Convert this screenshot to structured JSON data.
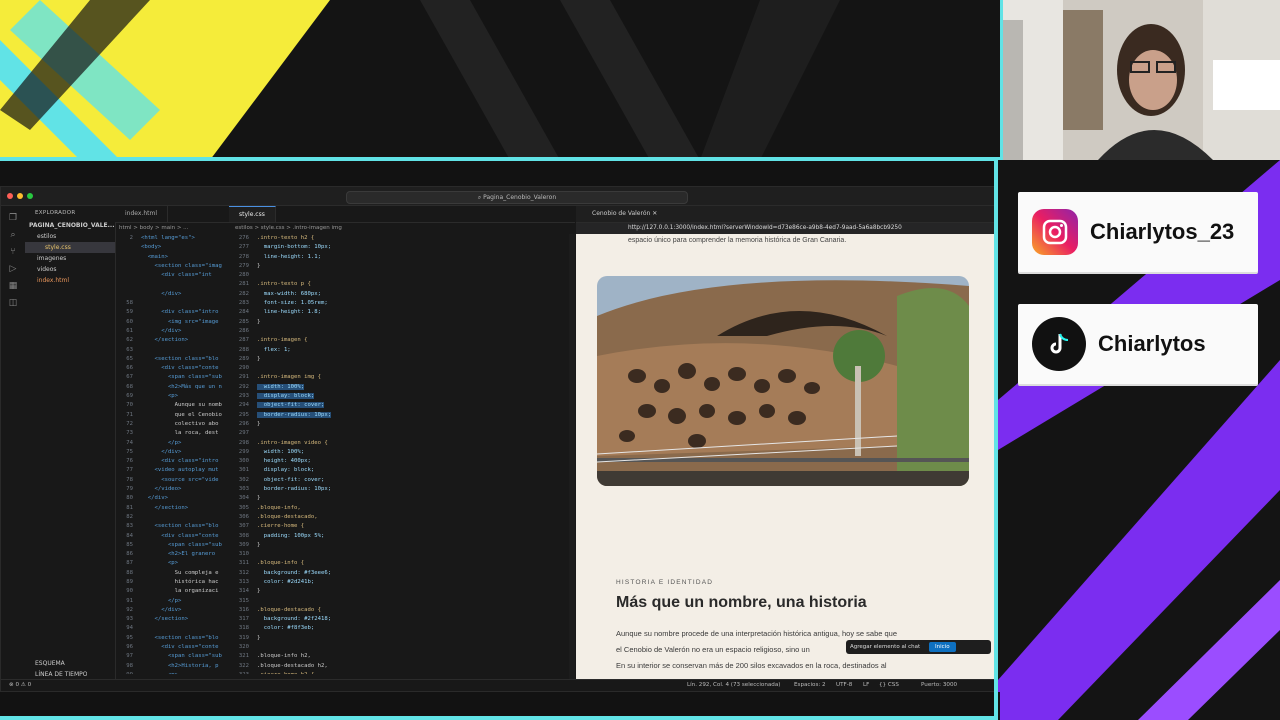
{
  "socials": {
    "instagram": "Chiarlytos_23",
    "tiktok": "Chiarlytos"
  },
  "editor": {
    "command_center": "Pagina_Cenobio_Valeron",
    "explorer_title": "EXPLORADOR",
    "project": "PAGINA_CENOBIO_VALE...",
    "tree": [
      "estilos",
      "style.css",
      "imagenes",
      "videos",
      "index.html"
    ],
    "outline": "ESQUEMA",
    "timeline": "LÍNEA DE TIEMPO",
    "tabs": [
      "index.html",
      "style.css"
    ],
    "breadcrumb_left": "html > body > main > ...",
    "breadcrumb_right": "estilos > style.css > .intro-imagen img",
    "html_lines": [
      {
        "n": "2",
        "c": "<html lang=\"es\">"
      },
      {
        "n": "",
        "c": "<body>"
      },
      {
        "n": "",
        "c": "  <main>"
      },
      {
        "n": "",
        "c": "    <section class=\"imag"
      },
      {
        "n": "",
        "c": "      <div class=\"int"
      },
      {
        "n": "",
        "c": ""
      },
      {
        "n": "",
        "c": "      </div>"
      },
      {
        "n": "58",
        "c": ""
      },
      {
        "n": "59",
        "c": "      <div class=\"intro"
      },
      {
        "n": "60",
        "c": "        <img src=\"image"
      },
      {
        "n": "61",
        "c": "      </div>"
      },
      {
        "n": "62",
        "c": "    </section>"
      },
      {
        "n": "63",
        "c": ""
      },
      {
        "n": "65",
        "c": "    <section class=\"blo"
      },
      {
        "n": "66",
        "c": "      <div class=\"conte"
      },
      {
        "n": "67",
        "c": "        <span class=\"sub"
      },
      {
        "n": "68",
        "c": "        <h2>Más que un n"
      },
      {
        "n": "69",
        "c": "        <p>"
      },
      {
        "n": "70",
        "c": "          Aunque su nomb"
      },
      {
        "n": "71",
        "c": "          que el Cenobio"
      },
      {
        "n": "72",
        "c": "          colectivo abo"
      },
      {
        "n": "73",
        "c": "          la roca, dest"
      },
      {
        "n": "74",
        "c": "        </p>"
      },
      {
        "n": "75",
        "c": "      </div>"
      },
      {
        "n": "76",
        "c": "      <div class=\"intro"
      },
      {
        "n": "77",
        "c": "    <video autoplay mut"
      },
      {
        "n": "78",
        "c": "      <source src=\"vide"
      },
      {
        "n": "79",
        "c": "    </video>"
      },
      {
        "n": "80",
        "c": "  </div>"
      },
      {
        "n": "81",
        "c": "    </section>"
      },
      {
        "n": "82",
        "c": ""
      },
      {
        "n": "83",
        "c": "    <section class=\"blo"
      },
      {
        "n": "84",
        "c": "      <div class=\"conte"
      },
      {
        "n": "85",
        "c": "        <span class=\"sub"
      },
      {
        "n": "86",
        "c": "        <h2>El granero"
      },
      {
        "n": "87",
        "c": "        <p>"
      },
      {
        "n": "88",
        "c": "          Su compleja e"
      },
      {
        "n": "89",
        "c": "          histórica hac"
      },
      {
        "n": "90",
        "c": "          la organizaci"
      },
      {
        "n": "91",
        "c": "        </p>"
      },
      {
        "n": "92",
        "c": "      </div>"
      },
      {
        "n": "93",
        "c": "    </section>"
      },
      {
        "n": "94",
        "c": ""
      },
      {
        "n": "95",
        "c": "    <section class=\"blo"
      },
      {
        "n": "96",
        "c": "      <div class=\"conte"
      },
      {
        "n": "97",
        "c": "        <span class=\"sub"
      },
      {
        "n": "98",
        "c": "        <h2>Historia, p"
      },
      {
        "n": "99",
        "c": "        <p>"
      }
    ],
    "css_lines": [
      {
        "n": "276",
        "c": ".intro-texto h2 {"
      },
      {
        "n": "277",
        "c": "  margin-bottom: 10px;"
      },
      {
        "n": "278",
        "c": "  line-height: 1.1;"
      },
      {
        "n": "279",
        "c": "}"
      },
      {
        "n": "280",
        "c": ""
      },
      {
        "n": "281",
        "c": ".intro-texto p {"
      },
      {
        "n": "282",
        "c": "  max-width: 680px;"
      },
      {
        "n": "283",
        "c": "  font-size: 1.05rem;"
      },
      {
        "n": "284",
        "c": "  line-height: 1.8;"
      },
      {
        "n": "285",
        "c": "}"
      },
      {
        "n": "286",
        "c": ""
      },
      {
        "n": "287",
        "c": ".intro-imagen {"
      },
      {
        "n": "288",
        "c": "  flex: 1;"
      },
      {
        "n": "289",
        "c": "}"
      },
      {
        "n": "290",
        "c": ""
      },
      {
        "n": "291",
        "c": ".intro-imagen img {"
      },
      {
        "n": "292",
        "c": "  width: 100%;"
      },
      {
        "n": "293",
        "c": "  display: block;"
      },
      {
        "n": "294",
        "c": "  object-fit: cover;"
      },
      {
        "n": "295",
        "c": "  border-radius: 10px;"
      },
      {
        "n": "296",
        "c": "}"
      },
      {
        "n": "297",
        "c": ""
      },
      {
        "n": "298",
        "c": ".intro-imagen video {"
      },
      {
        "n": "299",
        "c": "  width: 100%;"
      },
      {
        "n": "300",
        "c": "  height: 400px;"
      },
      {
        "n": "301",
        "c": "  display: block;"
      },
      {
        "n": "302",
        "c": "  object-fit: cover;"
      },
      {
        "n": "303",
        "c": "  border-radius: 10px;"
      },
      {
        "n": "304",
        "c": "}"
      },
      {
        "n": "305",
        "c": ".bloque-info,"
      },
      {
        "n": "306",
        "c": ".bloque-destacado,"
      },
      {
        "n": "307",
        "c": ".cierre-home {"
      },
      {
        "n": "308",
        "c": "  padding: 100px 5%;"
      },
      {
        "n": "309",
        "c": "}"
      },
      {
        "n": "310",
        "c": ""
      },
      {
        "n": "311",
        "c": ".bloque-info {"
      },
      {
        "n": "312",
        "c": "  background: #f3eee6;"
      },
      {
        "n": "313",
        "c": "  color: #2d241b;"
      },
      {
        "n": "314",
        "c": "}"
      },
      {
        "n": "315",
        "c": ""
      },
      {
        "n": "316",
        "c": ".bloque-destacado {"
      },
      {
        "n": "317",
        "c": "  background: #2f2418;"
      },
      {
        "n": "318",
        "c": "  color: #f8f3eb;"
      },
      {
        "n": "319",
        "c": "}"
      },
      {
        "n": "320",
        "c": ""
      },
      {
        "n": "321",
        "c": ".bloque-info h2,"
      },
      {
        "n": "322",
        "c": ".bloque-destacado h2,"
      },
      {
        "n": "323",
        "c": ".cierre-home h2 {"
      }
    ],
    "status": {
      "left": "⊗ 0 ⚠ 0",
      "cursor": "Lín. 292, Col. 4 (73 seleccionada)",
      "spaces": "Espacios: 2",
      "encoding": "UTF-8",
      "eol": "LF",
      "lang": "{} CSS",
      "port": "Puerto: 3000"
    }
  },
  "browser": {
    "tab_title": "Cenobio de Valerón",
    "url": "http://127.0.0.1:3000/index.html?serverWindowId=d73e86ce-a9b8-4ed7-9aad-5a6a8bcb9250",
    "top_text": "espacio único para comprender la memoria histórica de Gran Canaria.",
    "eyebrow": "HISTORIA E IDENTIDAD",
    "heading": "Más que un nombre, una historia",
    "paragraph_1": "Aunque su nombre procede de una interpretación histórica antigua, hoy se sabe que",
    "paragraph_2": "el Cenobio de Valerón no era un espacio religioso, sino un",
    "paragraph_3": "En su interior se conservan más de 200 silos excavados en la roca, destinados al",
    "chat_label": "Agregar elemento al chat",
    "chat_button": "Inicio"
  }
}
